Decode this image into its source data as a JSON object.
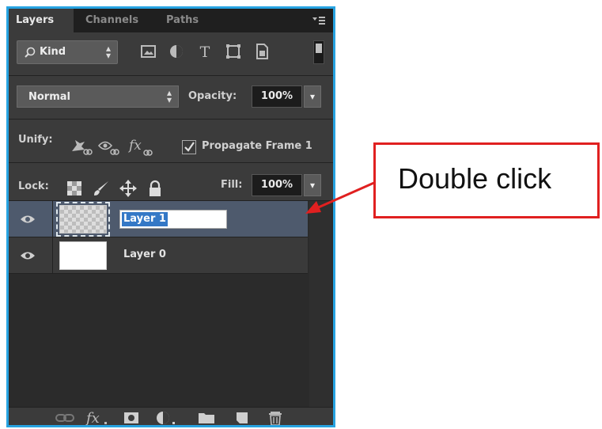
{
  "panel": {
    "tabs": [
      "Layers",
      "Channels",
      "Paths"
    ],
    "active_tab": "Layers",
    "filter": {
      "kind_label": "Kind"
    },
    "blend": {
      "mode": "Normal",
      "opacity_label": "Opacity:",
      "opacity_value": "100%"
    },
    "unify": {
      "label": "Unify:",
      "propagate_label": "Propagate Frame 1",
      "propagate_checked": true
    },
    "lock": {
      "label": "Lock:",
      "fill_label": "Fill:",
      "fill_value": "100%"
    },
    "layers": [
      {
        "name": "Layer 1",
        "selected": true,
        "editing": true,
        "thumbnail": "transparent"
      },
      {
        "name": "Layer 0",
        "selected": false,
        "editing": false,
        "thumbnail": "white"
      }
    ]
  },
  "callout": {
    "text": "Double click"
  },
  "colors": {
    "panel_border": "#27a3e1",
    "callout_border": "#e02020",
    "selection": "#3478c6"
  }
}
